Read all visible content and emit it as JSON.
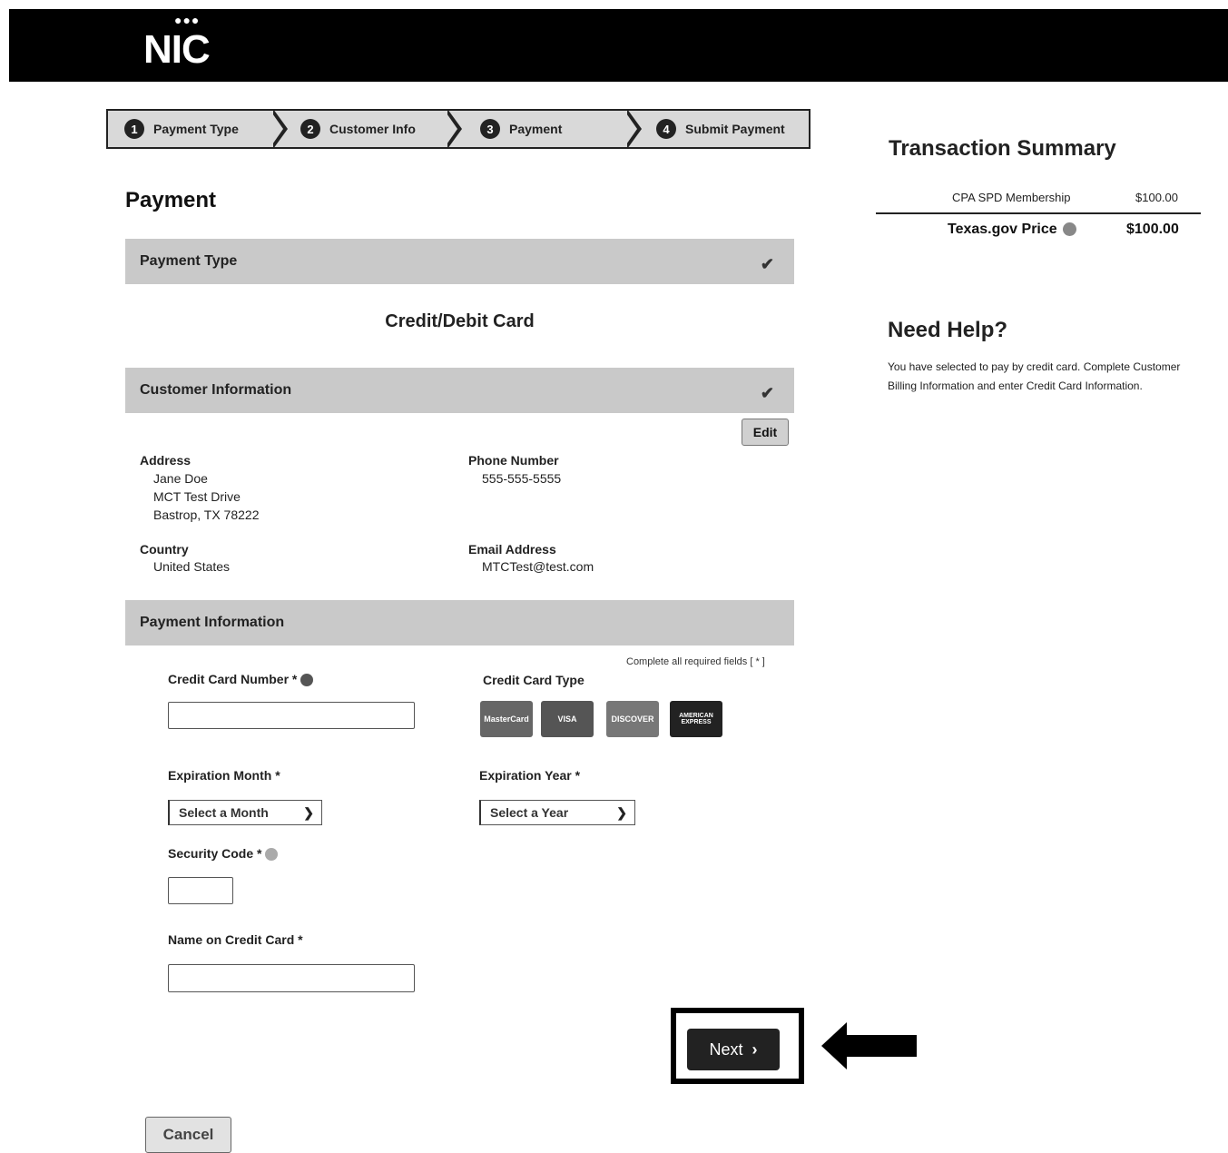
{
  "header": {
    "logo": "NIC"
  },
  "stepper": {
    "steps": [
      {
        "num": "1",
        "label": "Payment Type"
      },
      {
        "num": "2",
        "label": "Customer Info"
      },
      {
        "num": "3",
        "label": "Payment"
      },
      {
        "num": "4",
        "label": "Submit Payment"
      }
    ]
  },
  "page": {
    "title": "Payment"
  },
  "payment_type": {
    "header": "Payment Type",
    "value": "Credit/Debit Card"
  },
  "customer": {
    "header": "Customer Information",
    "edit_label": "Edit",
    "address_label": "Address",
    "address_lines": [
      "Jane Doe",
      "MCT Test Drive",
      "Bastrop, TX 78222"
    ],
    "phone_label": "Phone Number",
    "phone": "555-555-5555",
    "country_label": "Country",
    "country": "United States",
    "email_label": "Email Address",
    "email": "MTCTest@test.com"
  },
  "payment_info": {
    "header": "Payment Information",
    "required_note": "Complete all required fields [ * ]",
    "cc_number_label": "Credit Card Number *",
    "cc_type_label": "Credit Card Type",
    "cards": [
      "MasterCard",
      "VISA",
      "DISCOVER",
      "AMERICAN EXPRESS"
    ],
    "exp_month_label": "Expiration Month *",
    "exp_month_value": "Select a Month",
    "exp_year_label": "Expiration Year *",
    "exp_year_value": "Select a Year",
    "security_label": "Security Code *",
    "name_label": "Name on Credit Card *"
  },
  "actions": {
    "next": "Next",
    "cancel": "Cancel"
  },
  "summary": {
    "title": "Transaction Summary",
    "item_name": "CPA SPD Membership",
    "item_price": "$100.00",
    "total_label": "Texas.gov Price",
    "total_price": "$100.00"
  },
  "help": {
    "title": "Need Help?",
    "text": "You have selected to pay by credit card. Complete Customer Billing Information and enter Credit Card Information."
  },
  "colors": {
    "header_bg": "#000000",
    "section_bar": "#c9c9c9",
    "button_dark": "#222222"
  }
}
